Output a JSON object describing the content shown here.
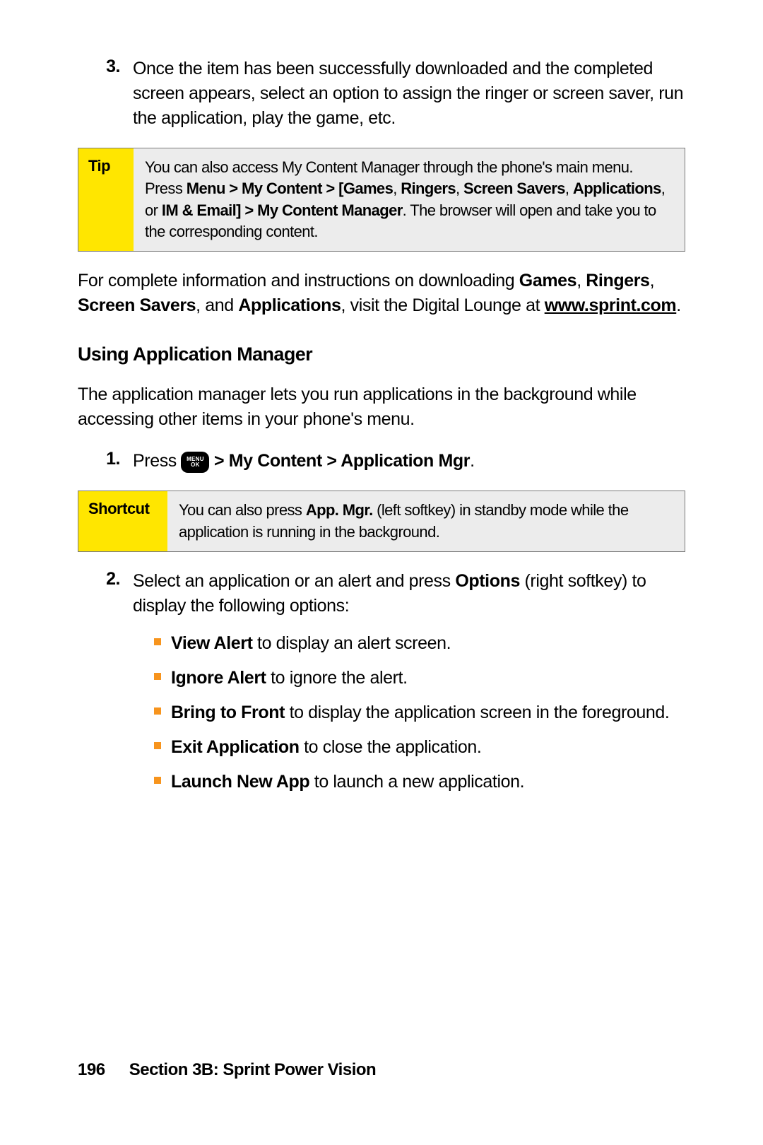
{
  "step3": {
    "num": "3.",
    "text": "Once the item has been successfully downloaded and the completed screen appears, select an option to assign the ringer or screen saver, run the application, play the game, etc."
  },
  "tip": {
    "label": "Tip",
    "t1": "You can also access My Content Manager through the phone's main menu. Press ",
    "b1": "Menu > My Content > [Games",
    "t2": ", ",
    "b2": "Ringers",
    "t3": ", ",
    "b3": "Screen Savers",
    "t4": ", ",
    "b4": "Applications",
    "t5": ", or ",
    "b5": "IM & Email] > My Content Manager",
    "t6": ". The browser will open and take you to the corresponding content."
  },
  "para1": {
    "t1": "For complete information and instructions on downloading ",
    "b1": "Games",
    "t2": ", ",
    "b2": "Ringers",
    "t3": ", ",
    "b3": "Screen Savers",
    "t4": ", and ",
    "b4": "Applications",
    "t5": ", visit the Digital Lounge at ",
    "url": "www.sprint.com",
    "t6": "."
  },
  "heading": "Using Application Manager",
  "para2": "The application manager lets you run applications in the background while accessing other items in your phone's menu.",
  "step1b": {
    "num": "1.",
    "t1": "Press ",
    "menu_top": "MENU",
    "menu_bot": "OK",
    "b1": " > My Content > Application Mgr",
    "t2": "."
  },
  "shortcut": {
    "label": "Shortcut",
    "t1": "You can also press ",
    "b1": "App. Mgr.",
    "t2": " (left softkey) in standby mode while the application is running in the background."
  },
  "step2b": {
    "num": "2.",
    "t1": "Select an application or an alert and press ",
    "b1": "Options",
    "t2": " (right softkey) to display the following options:"
  },
  "opts": [
    {
      "b": "View Alert",
      "t": " to display an alert screen."
    },
    {
      "b": "Ignore Alert",
      "t": " to ignore the alert."
    },
    {
      "b": "Bring to Front",
      "t": " to display the application screen in the foreground."
    },
    {
      "b": "Exit Application",
      "t": " to close the application."
    },
    {
      "b": "Launch New App",
      "t": " to launch a new application."
    }
  ],
  "footer": {
    "page": "196",
    "section": "Section 3B: Sprint Power Vision"
  }
}
